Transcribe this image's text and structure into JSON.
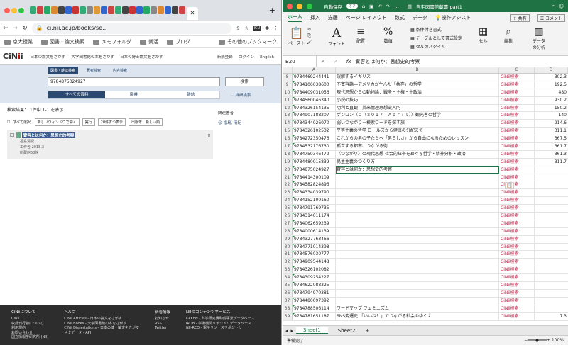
{
  "browser": {
    "url": "ci.nii.ac.jp/books/se...",
    "bookmarks": [
      "京大授業",
      "図書・論文検索",
      "メモフォルダ",
      "就活",
      "ブログ"
    ],
    "other_bookmarks": "その他のブックマーク",
    "ext_badge": "ICU"
  },
  "cinii": {
    "logo": "CiNii",
    "top_links": [
      "日本の論文をさがす",
      "大学図書館の本をさがす",
      "日本の博士論文をさがす"
    ],
    "user_links": [
      "新規登録",
      "ログイン",
      "English"
    ],
    "search_tabs": [
      "図書・雑誌検索",
      "著者検索",
      "内容検索"
    ],
    "query": "9784875024927",
    "search_button": "検索",
    "nav": [
      "すべての資料",
      "図書",
      "雑誌"
    ],
    "advanced": "詳細検索",
    "result_header": "検索結果： 1件中 1-1 を表示",
    "controls": {
      "select_all": "すべて選択:",
      "window_option": "新しいウィンドウで開く",
      "run": "実行",
      "sort": "20件ずつ表示",
      "year": "出版年：新しい順"
    },
    "result": {
      "title": "實容とは何か：思想史的考察",
      "author": "福島清紀",
      "publisher": "工作舎 2018.3",
      "holdings": "所蔵館58館"
    },
    "related_label": "関連著者",
    "related_author": "福島, 清紀",
    "footer": [
      {
        "h": "CiNiiについて",
        "items": [
          "CiNii",
          "収録刊行物について",
          "利用規約",
          "お問い合わせ",
          "国立情報学研究所 (NII)"
        ]
      },
      {
        "h": "ヘルプ",
        "items": [
          "CiNii Articles - 日本の論文をさがす",
          "CiNii Books - 大学図書館の本をさがす",
          "CiNii Dissertations - 日本の博士論文をさがす",
          "メタデータ・API"
        ]
      },
      {
        "h": "新着情報",
        "items": [
          "お知らせ",
          "RSS",
          "Twitter"
        ]
      },
      {
        "h": "NIIのコンテンツサービス",
        "items": [
          "KAKEN - 科学研究費助成事業データベース",
          "IRDB - 学術機関リポジトリデータベース",
          "NII-REO - 電子リソースリポジトリ"
        ]
      }
    ]
  },
  "excel": {
    "autosave": "自動保存",
    "autosave_state": "オフ",
    "filename": "自宅図書館蔵書 part1",
    "tabs": [
      "ホーム",
      "挿入",
      "描画",
      "ページ レイアウト",
      "数式",
      "データ",
      "操作アシスト"
    ],
    "share": "共有",
    "comment": "コメント",
    "ribbon": {
      "paste": "ペースト",
      "font": "フォント",
      "align": "配置",
      "number": "数値",
      "cond": "条件付き書式",
      "table": "テーブルとして書式設定",
      "style": "セルのスタイル",
      "cell": "セル",
      "edit": "編集",
      "analysis": "データ\nの分析"
    },
    "namebox": "B20",
    "formula": "實容とは何か：思想史的考察",
    "cols": [
      "A",
      "B",
      "C",
      "D"
    ],
    "rows": [
      {
        "n": "8",
        "a": "9784469244441",
        "b": "誤解するイギリス",
        "c": "CiNii検索",
        "d": "302.3"
      },
      {
        "n": "9",
        "a": "9784106038600",
        "b": "不寛容論―アメリカが生んだ「共存」の哲学",
        "c": "CiNii検索",
        "d": "192.5"
      },
      {
        "n": "10",
        "a": "9784409031056",
        "b": "現代思想からの動物論：戦争・主権・生政治",
        "c": "CiNii検索",
        "d": "480"
      },
      {
        "n": "11",
        "a": "9784560046340",
        "b": "小説の技巧",
        "c": "CiNii検索",
        "d": "930.2"
      },
      {
        "n": "12",
        "a": "9784326154135",
        "b": "功利と直観―英米倫理思想史入門",
        "c": "CiNii検索",
        "d": "150.2"
      },
      {
        "n": "13",
        "a": "9784907188207",
        "b": "ゲンロン（０（２０１７　Ａｐｒｉｌ））観光客の哲学",
        "c": "CiNii検索",
        "d": "140"
      },
      {
        "n": "14",
        "a": "9784344026070",
        "b": "弱いつながり－検索ワードを探す旅",
        "c": "CiNii検索",
        "d": "914.6"
      },
      {
        "n": "15",
        "a": "9784326102532",
        "b": "平等主義の哲学 ロールズから健康の分配まで",
        "c": "CiNii検索",
        "d": "311.1"
      },
      {
        "n": "16",
        "a": "9784272350476",
        "b": "これからの男の子たちへ「男らしさ」から自由になるためのレッスン",
        "c": "CiNii検索",
        "d": "367.5"
      },
      {
        "n": "17",
        "a": "9784532176730",
        "b": "孤立する都市、つながる街",
        "c": "CiNii検索",
        "d": "361.7"
      },
      {
        "n": "18",
        "a": "9784750346472",
        "b": "〈つながり〉の現代思想 社会的紐帯をめぐる哲学・精神分析・政治",
        "c": "CiNii検索",
        "d": "361.3"
      },
      {
        "n": "19",
        "a": "9784480015839",
        "b": "民主主義のつくり方",
        "c": "CiNii検索",
        "d": "311.7"
      },
      {
        "n": "20",
        "a": "9784875024927",
        "b": "實容とは何か：思想史的考察",
        "c": "CiNii検索",
        "d": ""
      },
      {
        "n": "21",
        "a": "9784414300109",
        "b": "",
        "c": "CiNii検索",
        "d": ""
      },
      {
        "n": "22",
        "a": "9784582824896",
        "b": "",
        "c": "CiNii検索",
        "d": ""
      },
      {
        "n": "23",
        "a": "9784334039790",
        "b": "",
        "c": "CiNii検索",
        "d": ""
      },
      {
        "n": "24",
        "a": "9784152100160",
        "b": "",
        "c": "CiNii検索",
        "d": ""
      },
      {
        "n": "25",
        "a": "9784791769735",
        "b": "",
        "c": "CiNii検索",
        "d": ""
      },
      {
        "n": "26",
        "a": "9784314011174",
        "b": "",
        "c": "CiNii検索",
        "d": ""
      },
      {
        "n": "27",
        "a": "9784062659239",
        "b": "",
        "c": "CiNii検索",
        "d": ""
      },
      {
        "n": "28",
        "a": "9784000614139",
        "b": "",
        "c": "CiNii検索",
        "d": ""
      },
      {
        "n": "29",
        "a": "9784327763466",
        "b": "",
        "c": "CiNii検索",
        "d": ""
      },
      {
        "n": "30",
        "a": "9784771014398",
        "b": "",
        "c": "CiNii検索",
        "d": ""
      },
      {
        "n": "31",
        "a": "9784576030777",
        "b": "",
        "c": "CiNii検索",
        "d": ""
      },
      {
        "n": "32",
        "a": "9784909544148",
        "b": "",
        "c": "CiNii検索",
        "d": ""
      },
      {
        "n": "33",
        "a": "9784326102082",
        "b": "",
        "c": "CiNii検索",
        "d": ""
      },
      {
        "n": "34",
        "a": "9784309254227",
        "b": "",
        "c": "CiNii検索",
        "d": ""
      },
      {
        "n": "35",
        "a": "9784622088325",
        "b": "",
        "c": "CiNii検索",
        "d": ""
      },
      {
        "n": "36",
        "a": "9784794970381",
        "b": "",
        "c": "CiNii検索",
        "d": ""
      },
      {
        "n": "37",
        "a": "9784480097392",
        "b": "",
        "c": "CiNii検索",
        "d": ""
      },
      {
        "n": "38",
        "a": "9784788506114",
        "b": "ワードマップ フェミニズム",
        "c": "CiNii検索",
        "d": ""
      },
      {
        "n": "39",
        "a": "9784781651187",
        "b": "SNS変遷史 「いいね！」でつながる社会のゆくえ",
        "c": "CiNii検索",
        "d": "7.3"
      }
    ],
    "sheets": [
      "Sheet1",
      "Sheet2"
    ],
    "status": "準備完了",
    "zoom": "100%"
  }
}
